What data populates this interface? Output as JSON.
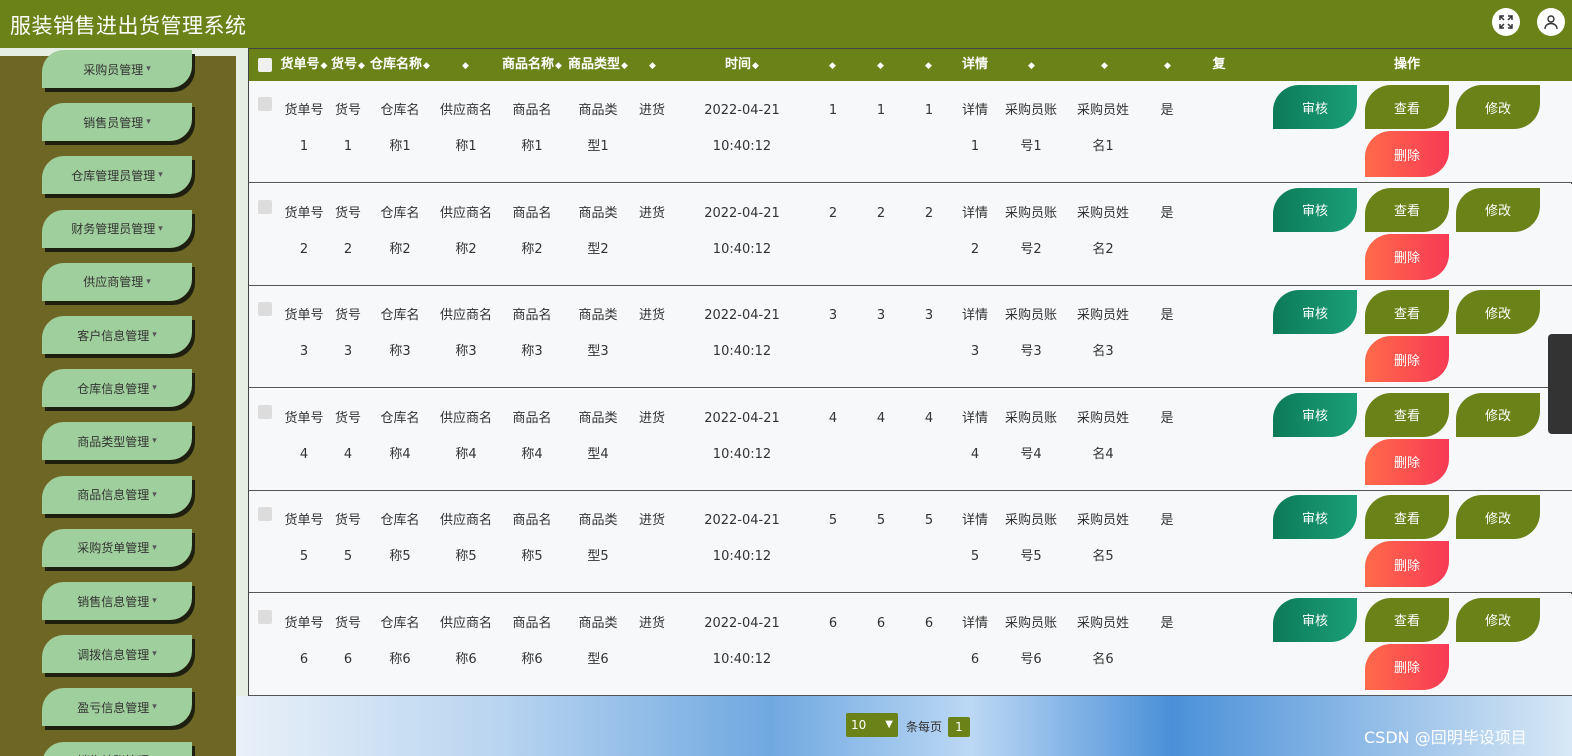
{
  "app": {
    "title": "服装销售进出货管理系统"
  },
  "icons": {
    "fullscreen": "fullscreen-icon",
    "user": "user-icon"
  },
  "sidebar": {
    "items": [
      {
        "label": "采购员管理"
      },
      {
        "label": "销售员管理"
      },
      {
        "label": "仓库管理员管理"
      },
      {
        "label": "财务管理员管理"
      },
      {
        "label": "供应商管理"
      },
      {
        "label": "客户信息管理"
      },
      {
        "label": "仓库信息管理"
      },
      {
        "label": "商品类型管理"
      },
      {
        "label": "商品信息管理"
      },
      {
        "label": "采购货单管理"
      },
      {
        "label": "销售信息管理"
      },
      {
        "label": "调拨信息管理"
      },
      {
        "label": "盈亏信息管理"
      },
      {
        "label": "销售结账管理"
      }
    ]
  },
  "table": {
    "headers": {
      "h1": "货单号",
      "h2": "货号",
      "h3": "仓库名称",
      "h5": "商品名称",
      "h6": "商品类型",
      "h8": "时间",
      "h12": "详情",
      "h16": "复",
      "h17": "操作"
    },
    "rows": [
      {
        "a1": "货单号",
        "b1": "1",
        "a2": "货号",
        "b2": "1",
        "a3": "仓库名",
        "b3": "称1",
        "a4": "供应商名",
        "b4": "称1",
        "a5": "商品名",
        "b5": "称1",
        "a6": "商品类",
        "b6": "型1",
        "type": "进货",
        "date": "2022-04-21",
        "time": "10:40:12",
        "n1": "1",
        "n2": "1",
        "n3": "1",
        "a7": "详情",
        "b7": "1",
        "a8": "采购员账",
        "b8": "号1",
        "a9": "采购员姓",
        "b9": "名1",
        "flag": "是"
      },
      {
        "a1": "货单号",
        "b1": "2",
        "a2": "货号",
        "b2": "2",
        "a3": "仓库名",
        "b3": "称2",
        "a4": "供应商名",
        "b4": "称2",
        "a5": "商品名",
        "b5": "称2",
        "a6": "商品类",
        "b6": "型2",
        "type": "进货",
        "date": "2022-04-21",
        "time": "10:40:12",
        "n1": "2",
        "n2": "2",
        "n3": "2",
        "a7": "详情",
        "b7": "2",
        "a8": "采购员账",
        "b8": "号2",
        "a9": "采购员姓",
        "b9": "名2",
        "flag": "是"
      },
      {
        "a1": "货单号",
        "b1": "3",
        "a2": "货号",
        "b2": "3",
        "a3": "仓库名",
        "b3": "称3",
        "a4": "供应商名",
        "b4": "称3",
        "a5": "商品名",
        "b5": "称3",
        "a6": "商品类",
        "b6": "型3",
        "type": "进货",
        "date": "2022-04-21",
        "time": "10:40:12",
        "n1": "3",
        "n2": "3",
        "n3": "3",
        "a7": "详情",
        "b7": "3",
        "a8": "采购员账",
        "b8": "号3",
        "a9": "采购员姓",
        "b9": "名3",
        "flag": "是"
      },
      {
        "a1": "货单号",
        "b1": "4",
        "a2": "货号",
        "b2": "4",
        "a3": "仓库名",
        "b3": "称4",
        "a4": "供应商名",
        "b4": "称4",
        "a5": "商品名",
        "b5": "称4",
        "a6": "商品类",
        "b6": "型4",
        "type": "进货",
        "date": "2022-04-21",
        "time": "10:40:12",
        "n1": "4",
        "n2": "4",
        "n3": "4",
        "a7": "详情",
        "b7": "4",
        "a8": "采购员账",
        "b8": "号4",
        "a9": "采购员姓",
        "b9": "名4",
        "flag": "是"
      },
      {
        "a1": "货单号",
        "b1": "5",
        "a2": "货号",
        "b2": "5",
        "a3": "仓库名",
        "b3": "称5",
        "a4": "供应商名",
        "b4": "称5",
        "a5": "商品名",
        "b5": "称5",
        "a6": "商品类",
        "b6": "型5",
        "type": "进货",
        "date": "2022-04-21",
        "time": "10:40:12",
        "n1": "5",
        "n2": "5",
        "n3": "5",
        "a7": "详情",
        "b7": "5",
        "a8": "采购员账",
        "b8": "号5",
        "a9": "采购员姓",
        "b9": "名5",
        "flag": "是"
      },
      {
        "a1": "货单号",
        "b1": "6",
        "a2": "货号",
        "b2": "6",
        "a3": "仓库名",
        "b3": "称6",
        "a4": "供应商名",
        "b4": "称6",
        "a5": "商品名",
        "b5": "称6",
        "a6": "商品类",
        "b6": "型6",
        "type": "进货",
        "date": "2022-04-21",
        "time": "10:40:12",
        "n1": "6",
        "n2": "6",
        "n3": "6",
        "a7": "详情",
        "b7": "6",
        "a8": "采购员账",
        "b8": "号6",
        "a9": "采购员姓",
        "b9": "名6",
        "flag": "是"
      }
    ],
    "actions": {
      "audit": "审核",
      "view": "查看",
      "edit": "修改",
      "delete": "删除"
    }
  },
  "pagination": {
    "page_size": "10",
    "per_page_label": "条每页",
    "current_page": "1"
  },
  "watermark": "CSDN @回明毕设项目"
}
